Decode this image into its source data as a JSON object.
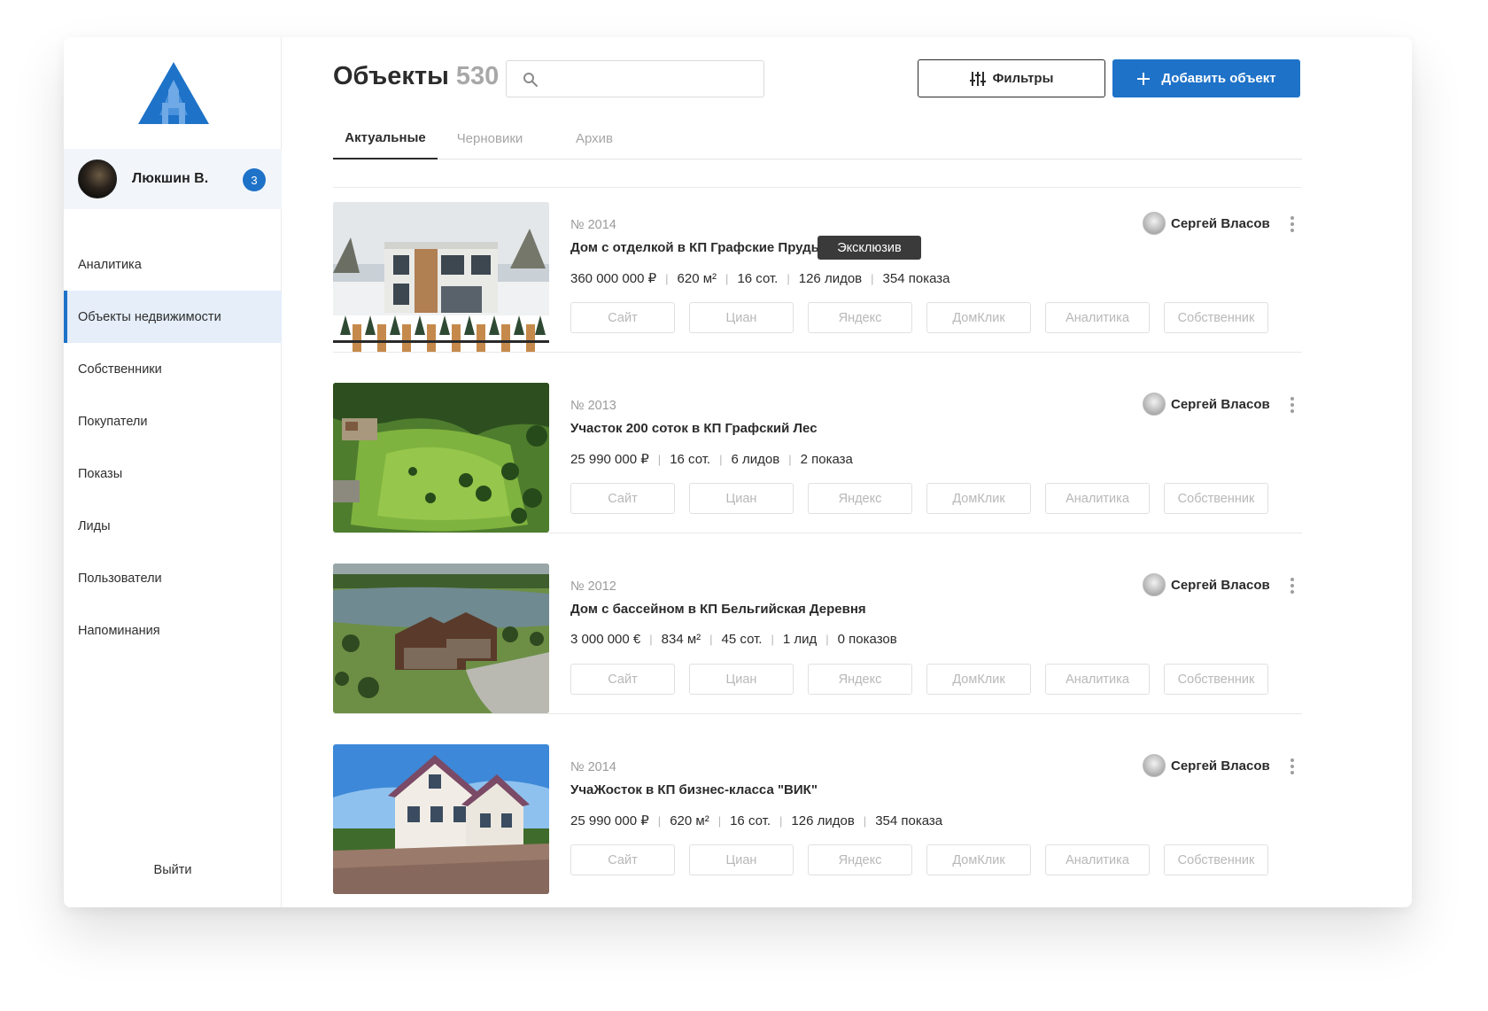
{
  "app": {
    "colors": {
      "accent": "#1e72c8",
      "active_nav_bg": "#e5eef9",
      "badge_dark": "#3a3a3a"
    }
  },
  "sidebar": {
    "logo_icon": "logo-a-triangle-icon",
    "user": {
      "name": "Люкшин В.",
      "notifications": "3"
    },
    "items": [
      {
        "label": "Аналитика",
        "active": false
      },
      {
        "label": "Объекты недвижимости",
        "active": true
      },
      {
        "label": "Собственники",
        "active": false
      },
      {
        "label": "Покупатели",
        "active": false
      },
      {
        "label": "Показы",
        "active": false
      },
      {
        "label": "Лиды",
        "active": false
      },
      {
        "label": "Пользователи",
        "active": false
      },
      {
        "label": "Напоминания",
        "active": false
      }
    ],
    "logout_label": "Выйти"
  },
  "header": {
    "title": "Объекты",
    "count": "530",
    "search": {
      "value": "",
      "placeholder": ""
    },
    "filters_label": "Фильтры",
    "add_label": "Добавить объект"
  },
  "tabs": [
    {
      "label": "Актуальные",
      "active": true
    },
    {
      "label": "Черновики",
      "active": false
    },
    {
      "label": "Архив",
      "active": false
    }
  ],
  "link_buttons": [
    "Сайт",
    "Циан",
    "Яндекс",
    "ДомКлик",
    "Аналитика",
    "Собственник"
  ],
  "listings": [
    {
      "number": "№ 2014",
      "title": "Дом с отделкой в КП Графские Пруды",
      "badge": "Эксклюзив",
      "stats": [
        "360 000 000 ₽",
        "620 м²",
        "16 сот.",
        "126 лидов",
        "354 показа"
      ],
      "agent": "Сергей Власов",
      "photo": "house-winter-photo"
    },
    {
      "number": "№ 2013",
      "title": "Участок 200 соток в КП Графский Лес",
      "badge": "",
      "stats": [
        "25 990 000 ₽",
        "16 сот.",
        "6 лидов",
        "2 показа"
      ],
      "agent": "Сергей Власов",
      "photo": "land-plot-aerial-photo"
    },
    {
      "number": "№ 2012",
      "title": "Дом с бассейном в КП Бельгийская Деревня",
      "badge": "",
      "stats": [
        "3 000 000 €",
        "834 м²",
        "45 сот.",
        "1 лид",
        "0 показов"
      ],
      "agent": "Сергей Власов",
      "photo": "house-lake-aerial-photo"
    },
    {
      "number": "№ 2014",
      "title": "УчаЖосток в КП бизнес-класса \"ВИК\"",
      "badge": "",
      "stats": [
        "25 990 000 ₽",
        "620 м²",
        "16 сот.",
        "126 лидов",
        "354 показа"
      ],
      "agent": "Сергей Власов",
      "photo": "house-summer-photo"
    }
  ]
}
